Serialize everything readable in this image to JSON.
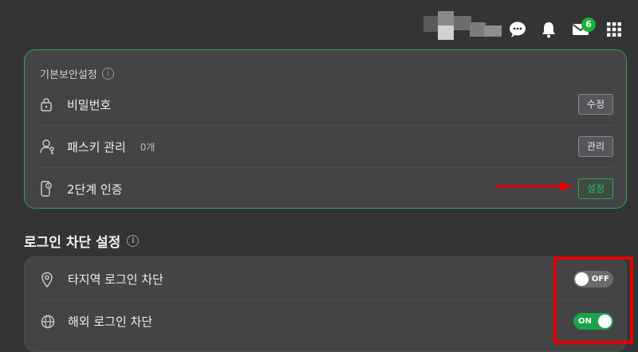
{
  "header": {
    "mail_badge_count": "6",
    "icons": [
      "chat-bubble-icon",
      "bell-icon",
      "mail-icon",
      "apps-grid-icon"
    ]
  },
  "basic_security": {
    "title": "기본보안설정",
    "rows": [
      {
        "icon": "lock-icon",
        "label": "비밀번호",
        "count": "",
        "button": "수정"
      },
      {
        "icon": "passkey-icon",
        "label": "패스키 관리",
        "count": "0개",
        "button": "관리"
      },
      {
        "icon": "phone-shield-icon",
        "label": "2단계 인증",
        "count": "",
        "button": "설정"
      }
    ]
  },
  "login_block": {
    "title": "로그인 차단 설정",
    "rows": [
      {
        "icon": "location-pin-icon",
        "label": "타지역 로그인 차단",
        "toggle_text": "OFF",
        "toggle_on": false
      },
      {
        "icon": "globe-icon",
        "label": "해외 로그인 차단",
        "toggle_text": "ON",
        "toggle_on": true
      }
    ]
  },
  "colors": {
    "accent_green": "#22c55e",
    "annotation_red": "#e60000",
    "background": "#343436",
    "card": "#444446"
  }
}
